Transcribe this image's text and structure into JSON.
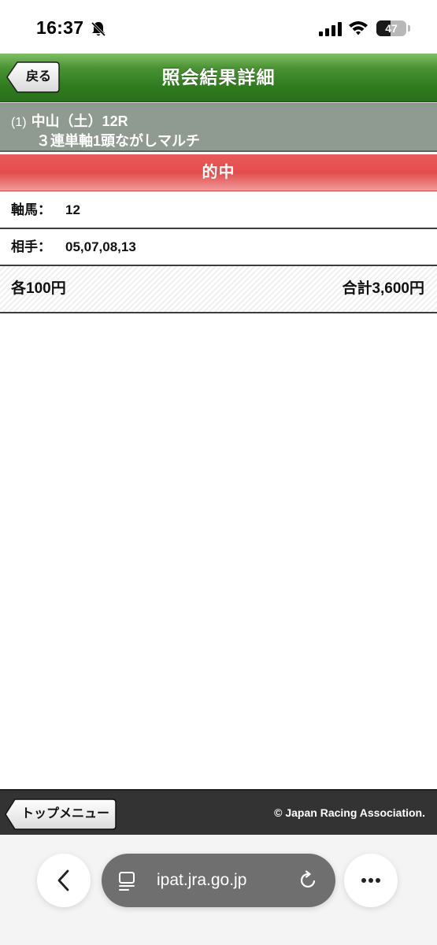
{
  "status_bar": {
    "time": "16:37",
    "battery_level": "47",
    "battery_fraction": 0.47
  },
  "header": {
    "title": "照会結果詳細",
    "back_label": "戻る"
  },
  "race": {
    "number": "(1)",
    "venue_day_race": "中山（土）12R",
    "bet_type": "３連単軸1頭ながしマルチ"
  },
  "result": {
    "label": "的中"
  },
  "details": {
    "axis_label": "軸馬：",
    "axis_value": "12",
    "partner_label": "相手：",
    "partner_value": "05,07,08,13"
  },
  "amount": {
    "each": "各100円",
    "total": "合計3,600円"
  },
  "footer": {
    "top_menu_label": "トップメニュー",
    "copyright": "© Japan Racing Association."
  },
  "browser": {
    "url": "ipat.jra.go.jp"
  },
  "icons": {
    "bell": "bell-slash-icon",
    "signal": "cellular-signal-icon",
    "wifi": "wifi-icon",
    "browser_back": "chevron-left-icon",
    "page": "page-menu-icon",
    "reload": "reload-icon",
    "more": "ellipsis-icon"
  },
  "colors": {
    "header_green": "#2f7a1f",
    "race_band_gray": "#8f9a91",
    "hit_red": "#e34c4c",
    "footer_dark": "#333333"
  }
}
